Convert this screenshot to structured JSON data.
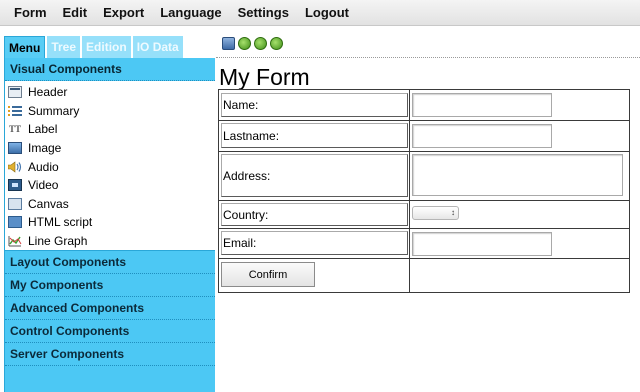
{
  "menu": {
    "items": [
      "Form",
      "Edit",
      "Export",
      "Language",
      "Settings",
      "Logout"
    ]
  },
  "left_tabs": [
    "Menu",
    "Tree",
    "Edition",
    "IO Data"
  ],
  "sections": {
    "visual": "Visual Components",
    "layout": "Layout Components",
    "my": "My Components",
    "advanced": "Advanced Components",
    "control": "Control Components",
    "server": "Server Components"
  },
  "visual_items": [
    {
      "label": "Header",
      "icon": "header-icon"
    },
    {
      "label": "Summary",
      "icon": "summary-icon"
    },
    {
      "label": "Label",
      "icon": "label-icon"
    },
    {
      "label": "Image",
      "icon": "image-icon"
    },
    {
      "label": "Audio",
      "icon": "audio-icon"
    },
    {
      "label": "Video",
      "icon": "video-icon"
    },
    {
      "label": "Canvas",
      "icon": "canvas-icon"
    },
    {
      "label": "HTML script",
      "icon": "html-script-icon"
    },
    {
      "label": "Line Graph",
      "icon": "line-graph-icon"
    }
  ],
  "label_icon_text": "TT",
  "form": {
    "title": "My Form",
    "fields": {
      "name": "Name:",
      "lastname": "Lastname:",
      "address": "Address:",
      "country": "Country:",
      "email": "Email:"
    },
    "confirm": "Confirm"
  },
  "colors": {
    "panel": "#4cc8f4",
    "tab_inactive": "#96e0fa"
  }
}
